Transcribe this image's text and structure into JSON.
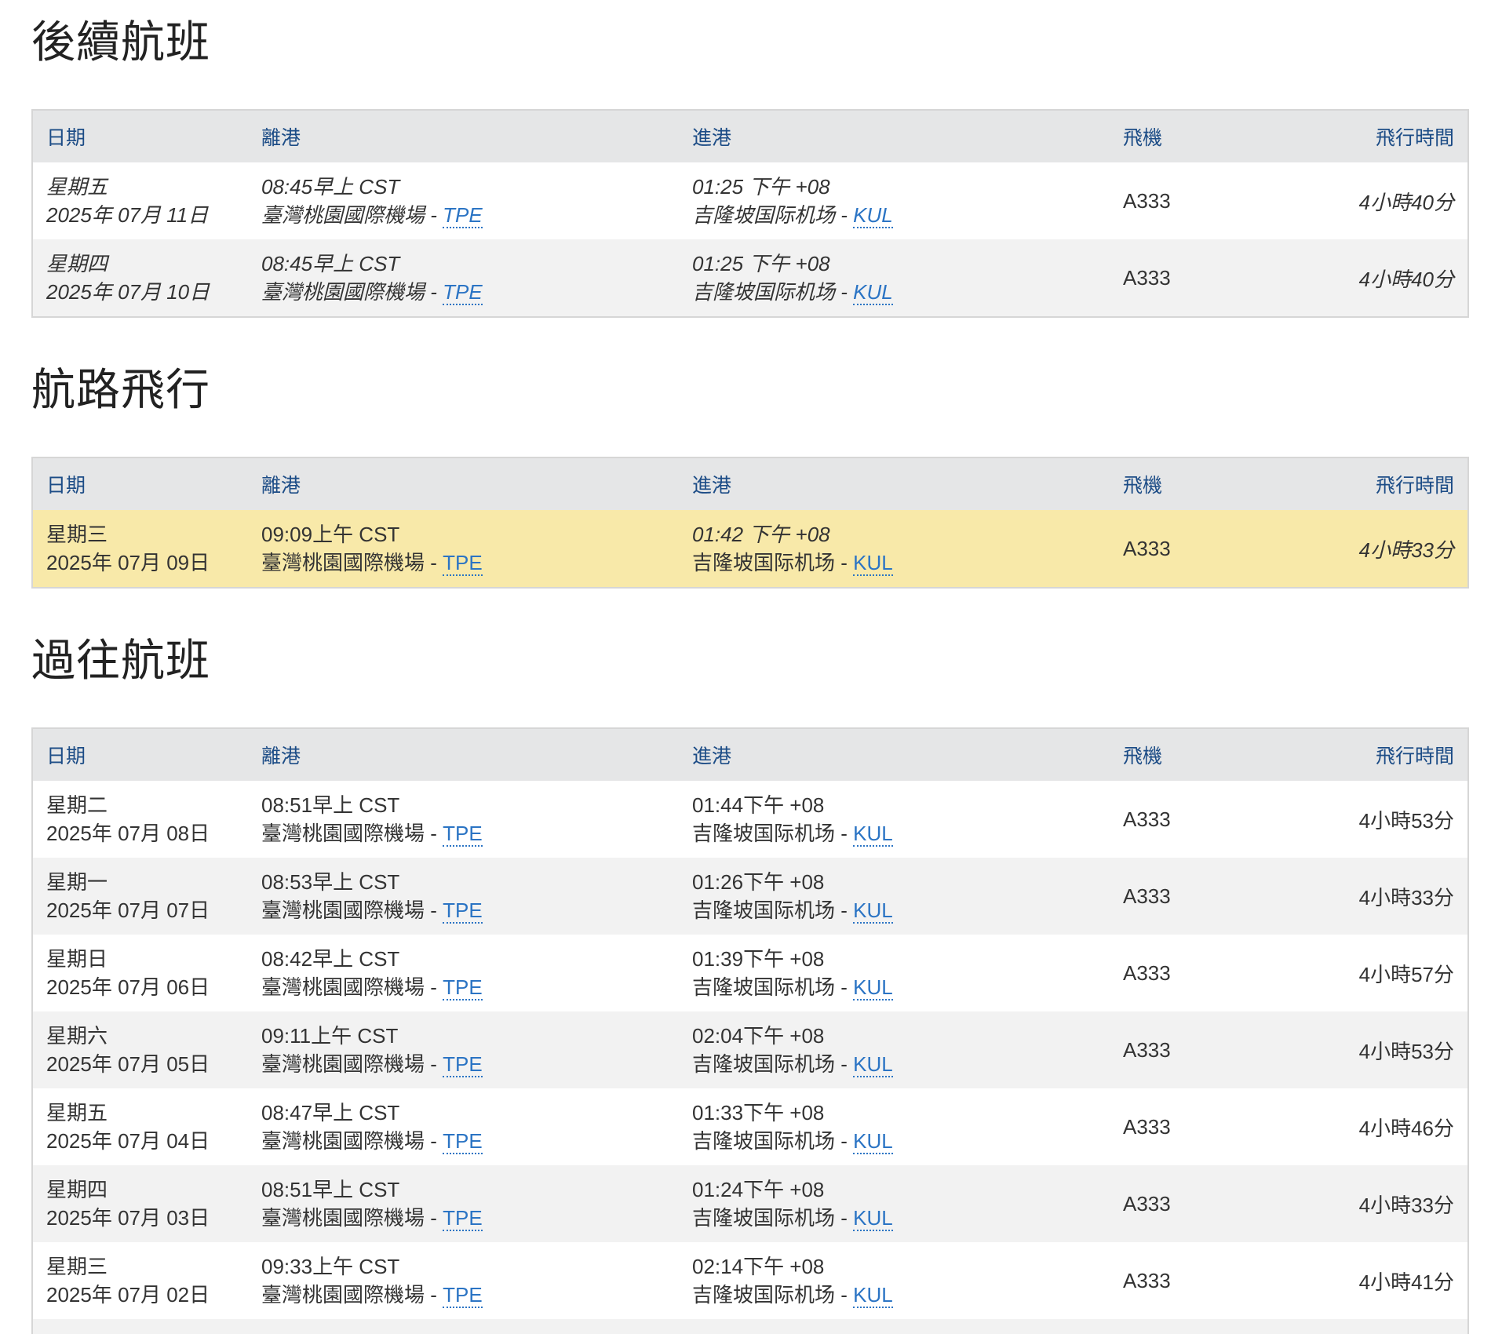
{
  "headers": {
    "date": "日期",
    "departure": "離港",
    "arrival": "進港",
    "aircraft": "飛機",
    "duration": "飛行時間"
  },
  "sections": [
    {
      "title": "後續航班",
      "rows": [
        {
          "weekday": "星期五",
          "date": "2025年 07月 11日",
          "dep_time": "08:45早上 CST",
          "dep_airport": "臺灣桃園國際機場",
          "dep_code": "TPE",
          "arr_time": "01:25 下午 +08",
          "arr_airport": "吉隆坡国际机场",
          "arr_code": "KUL",
          "aircraft": "A333",
          "duration": "4小時40分"
        },
        {
          "weekday": "星期四",
          "date": "2025年 07月 10日",
          "dep_time": "08:45早上 CST",
          "dep_airport": "臺灣桃園國際機場",
          "dep_code": "TPE",
          "arr_time": "01:25 下午 +08",
          "arr_airport": "吉隆坡国际机场",
          "arr_code": "KUL",
          "aircraft": "A333",
          "duration": "4小時40分"
        }
      ]
    },
    {
      "title": "航路飛行",
      "rows": [
        {
          "weekday": "星期三",
          "date": "2025年 07月 09日",
          "dep_time": "09:09上午 CST",
          "dep_airport": "臺灣桃園國際機場",
          "dep_code": "TPE",
          "arr_time": "01:42 下午 +08",
          "arr_airport": "吉隆坡国际机场",
          "arr_code": "KUL",
          "aircraft": "A333",
          "duration": "4小時33分"
        }
      ]
    },
    {
      "title": "過往航班",
      "rows": [
        {
          "weekday": "星期二",
          "date": "2025年 07月 08日",
          "dep_time": "08:51早上 CST",
          "dep_airport": "臺灣桃園國際機場",
          "dep_code": "TPE",
          "arr_time": "01:44下午 +08",
          "arr_airport": "吉隆坡国际机场",
          "arr_code": "KUL",
          "aircraft": "A333",
          "duration": "4小時53分"
        },
        {
          "weekday": "星期一",
          "date": "2025年 07月 07日",
          "dep_time": "08:53早上 CST",
          "dep_airport": "臺灣桃園國際機場",
          "dep_code": "TPE",
          "arr_time": "01:26下午 +08",
          "arr_airport": "吉隆坡国际机场",
          "arr_code": "KUL",
          "aircraft": "A333",
          "duration": "4小時33分"
        },
        {
          "weekday": "星期日",
          "date": "2025年 07月 06日",
          "dep_time": "08:42早上 CST",
          "dep_airport": "臺灣桃園國際機場",
          "dep_code": "TPE",
          "arr_time": "01:39下午 +08",
          "arr_airport": "吉隆坡国际机场",
          "arr_code": "KUL",
          "aircraft": "A333",
          "duration": "4小時57分"
        },
        {
          "weekday": "星期六",
          "date": "2025年 07月 05日",
          "dep_time": "09:11上午 CST",
          "dep_airport": "臺灣桃園國際機場",
          "dep_code": "TPE",
          "arr_time": "02:04下午 +08",
          "arr_airport": "吉隆坡国际机场",
          "arr_code": "KUL",
          "aircraft": "A333",
          "duration": "4小時53分"
        },
        {
          "weekday": "星期五",
          "date": "2025年 07月 04日",
          "dep_time": "08:47早上 CST",
          "dep_airport": "臺灣桃園國際機場",
          "dep_code": "TPE",
          "arr_time": "01:33下午 +08",
          "arr_airport": "吉隆坡国际机场",
          "arr_code": "KUL",
          "aircraft": "A333",
          "duration": "4小時46分"
        },
        {
          "weekday": "星期四",
          "date": "2025年 07月 03日",
          "dep_time": "08:51早上 CST",
          "dep_airport": "臺灣桃園國際機場",
          "dep_code": "TPE",
          "arr_time": "01:24下午 +08",
          "arr_airport": "吉隆坡国际机场",
          "arr_code": "KUL",
          "aircraft": "A333",
          "duration": "4小時33分"
        },
        {
          "weekday": "星期三",
          "date": "2025年 07月 02日",
          "dep_time": "09:33上午 CST",
          "dep_airport": "臺灣桃園國際機場",
          "dep_code": "TPE",
          "arr_time": "02:14下午 +08",
          "arr_airport": "吉隆坡国际机场",
          "arr_code": "KUL",
          "aircraft": "A333",
          "duration": "4小時41分"
        }
      ]
    }
  ],
  "colors": {
    "header_bg": "#e5e6e7",
    "header_text": "#1c4c86",
    "link": "#2b74c4",
    "current_row": "#f8e9a9"
  }
}
